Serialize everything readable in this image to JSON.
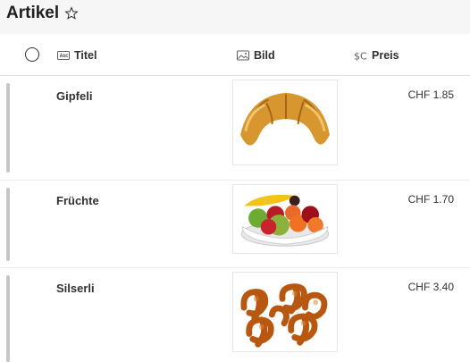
{
  "page": {
    "title": "Artikel"
  },
  "columns": {
    "title": "Titel",
    "image": "Bild",
    "price": "Preis"
  },
  "items": [
    {
      "name": "Gipfeli",
      "price": "CHF 1.85",
      "image_icon": "croissant-image"
    },
    {
      "name": "Früchte",
      "price": "CHF 1.70",
      "image_icon": "fruit-bowl-image"
    },
    {
      "name": "Silserli",
      "price": "CHF 3.40",
      "image_icon": "pretzel-image"
    }
  ],
  "colors": {
    "accent_bar": "#c8c6c4",
    "header_bg": "#f6f6f6"
  }
}
